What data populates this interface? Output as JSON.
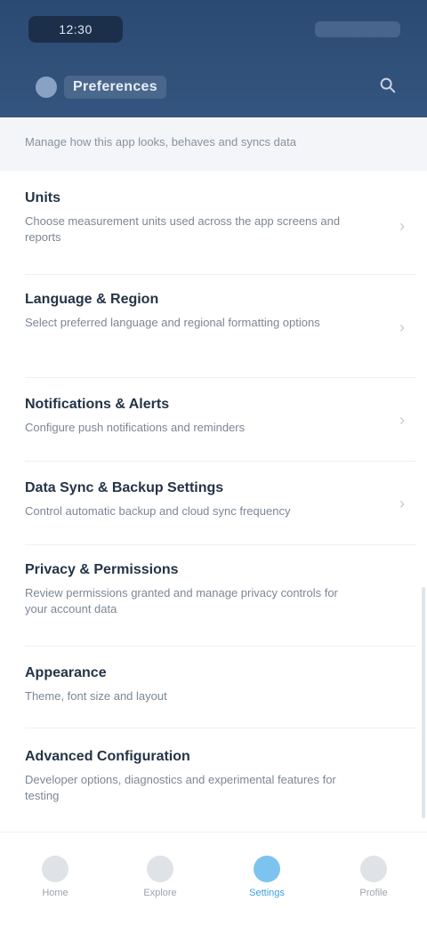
{
  "status_bar": {
    "time": "12:30"
  },
  "header": {
    "title": "Preferences"
  },
  "subheader": {
    "text": "Manage how this app looks, behaves and syncs data"
  },
  "items": [
    {
      "title": "Units",
      "desc": "Choose measurement units used across the app screens and reports"
    },
    {
      "title": "Language & Region",
      "desc": "Select preferred language and regional formatting options"
    },
    {
      "title": "Notifications & Alerts",
      "desc": "Configure push notifications and reminders"
    },
    {
      "title": "Data Sync & Backup Settings",
      "desc": "Control automatic backup and cloud sync frequency"
    },
    {
      "title": "Privacy & Permissions",
      "desc": "Review permissions granted and manage privacy controls for your account data"
    },
    {
      "title": "Appearance",
      "desc": "Theme, font size and layout"
    },
    {
      "title": "Advanced Configuration",
      "desc": "Developer options, diagnostics and experimental features for testing"
    }
  ],
  "bottom_nav": [
    {
      "label": "Home",
      "icon": "home-icon"
    },
    {
      "label": "Explore",
      "icon": "compass-icon"
    },
    {
      "label": "Settings",
      "icon": "gear-icon"
    },
    {
      "label": "Profile",
      "icon": "user-icon"
    }
  ],
  "colors": {
    "header_bg": "#2b4a73",
    "accent": "#3a9fdc"
  }
}
